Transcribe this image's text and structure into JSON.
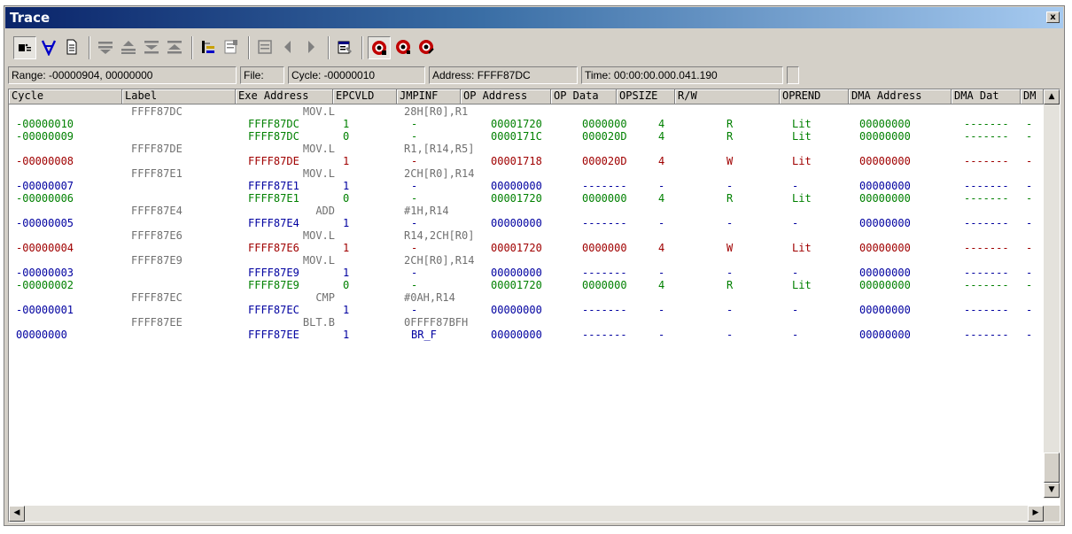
{
  "window": {
    "title": "Trace",
    "close_label": "x"
  },
  "toolbar": {
    "buttons": [
      {
        "icon": "acquisition-icon"
      },
      {
        "icon": "filter-icon"
      },
      {
        "icon": "document-icon"
      },
      {
        "icon": "find-icon"
      },
      {
        "icon": "find-prev-icon"
      },
      {
        "icon": "top-icon"
      },
      {
        "icon": "bottom-icon"
      },
      {
        "icon": "source-icon"
      },
      {
        "icon": "snapshot-icon"
      },
      {
        "icon": "view-icon"
      },
      {
        "icon": "back-icon"
      },
      {
        "icon": "forward-icon"
      },
      {
        "icon": "properties-icon"
      },
      {
        "icon": "trace-start-icon"
      },
      {
        "icon": "trace-stop-icon"
      },
      {
        "icon": "trace-clear-icon"
      }
    ]
  },
  "status": {
    "range": "Range: -00000904,  00000000",
    "file": "File:",
    "cycle": "Cycle: -00000010",
    "address": "Address: FFFF87DC",
    "time": "Time: 00:00:00.000.041.190"
  },
  "columns": [
    "Cycle",
    "Label",
    "Exe Address",
    "EPCVLD",
    "JMPINF",
    "OP Address",
    "OP Data",
    "OPSIZE",
    "R/W",
    "OPREND",
    "DMA Address",
    "DMA Dat",
    "DM"
  ],
  "colors": {
    "green": "#008000",
    "red": "#a00000",
    "blue": "#0000a0",
    "gray": "#707070",
    "toolbar_red": "#c00000",
    "toolbar_blue": "#0000c8"
  },
  "rows": [
    {
      "type": "asm",
      "label": "FFFF87DC",
      "mnemonic": "MOV.L",
      "operand": "28H[R0],R1"
    },
    {
      "type": "data",
      "color": "green",
      "cycle": "-00000010",
      "exe": "FFFF87DC",
      "epc": "1",
      "jmp": "-",
      "opaddr": "00001720",
      "opdata": "0000000",
      "opsize": "4",
      "rw": "R",
      "oprend": "Lit",
      "dmaaddr": "00000000",
      "dmadat": "-------",
      "dm": "-"
    },
    {
      "type": "data",
      "color": "green",
      "cycle": "-00000009",
      "exe": "FFFF87DC",
      "epc": "0",
      "jmp": "-",
      "opaddr": "0000171C",
      "opdata": "000020D",
      "opsize": "4",
      "rw": "R",
      "oprend": "Lit",
      "dmaaddr": "00000000",
      "dmadat": "-------",
      "dm": "-"
    },
    {
      "type": "asm",
      "label": "FFFF87DE",
      "mnemonic": "MOV.L",
      "operand": "R1,[R14,R5]"
    },
    {
      "type": "data",
      "color": "red",
      "cycle": "-00000008",
      "exe": "FFFF87DE",
      "epc": "1",
      "jmp": "-",
      "opaddr": "00001718",
      "opdata": "000020D",
      "opsize": "4",
      "rw": "W",
      "oprend": "Lit",
      "dmaaddr": "00000000",
      "dmadat": "-------",
      "dm": "-"
    },
    {
      "type": "asm",
      "label": "FFFF87E1",
      "mnemonic": "MOV.L",
      "operand": "2CH[R0],R14"
    },
    {
      "type": "data",
      "color": "blue",
      "cycle": "-00000007",
      "exe": "FFFF87E1",
      "epc": "1",
      "jmp": "-",
      "opaddr": "00000000",
      "opdata": "-------",
      "opsize": "-",
      "rw": "-",
      "oprend": "-",
      "dmaaddr": "00000000",
      "dmadat": "-------",
      "dm": "-"
    },
    {
      "type": "data",
      "color": "green",
      "cycle": "-00000006",
      "exe": "FFFF87E1",
      "epc": "0",
      "jmp": "-",
      "opaddr": "00001720",
      "opdata": "0000000",
      "opsize": "4",
      "rw": "R",
      "oprend": "Lit",
      "dmaaddr": "00000000",
      "dmadat": "-------",
      "dm": "-"
    },
    {
      "type": "asm",
      "label": "FFFF87E4",
      "mnemonic": "ADD",
      "operand": "#1H,R14"
    },
    {
      "type": "data",
      "color": "blue",
      "cycle": "-00000005",
      "exe": "FFFF87E4",
      "epc": "1",
      "jmp": "-",
      "opaddr": "00000000",
      "opdata": "-------",
      "opsize": "-",
      "rw": "-",
      "oprend": "-",
      "dmaaddr": "00000000",
      "dmadat": "-------",
      "dm": "-"
    },
    {
      "type": "asm",
      "label": "FFFF87E6",
      "mnemonic": "MOV.L",
      "operand": "R14,2CH[R0]"
    },
    {
      "type": "data",
      "color": "red",
      "cycle": "-00000004",
      "exe": "FFFF87E6",
      "epc": "1",
      "jmp": "-",
      "opaddr": "00001720",
      "opdata": "0000000",
      "opsize": "4",
      "rw": "W",
      "oprend": "Lit",
      "dmaaddr": "00000000",
      "dmadat": "-------",
      "dm": "-"
    },
    {
      "type": "asm",
      "label": "FFFF87E9",
      "mnemonic": "MOV.L",
      "operand": "2CH[R0],R14"
    },
    {
      "type": "data",
      "color": "blue",
      "cycle": "-00000003",
      "exe": "FFFF87E9",
      "epc": "1",
      "jmp": "-",
      "opaddr": "00000000",
      "opdata": "-------",
      "opsize": "-",
      "rw": "-",
      "oprend": "-",
      "dmaaddr": "00000000",
      "dmadat": "-------",
      "dm": "-"
    },
    {
      "type": "data",
      "color": "green",
      "cycle": "-00000002",
      "exe": "FFFF87E9",
      "epc": "0",
      "jmp": "-",
      "opaddr": "00001720",
      "opdata": "0000000",
      "opsize": "4",
      "rw": "R",
      "oprend": "Lit",
      "dmaaddr": "00000000",
      "dmadat": "-------",
      "dm": "-"
    },
    {
      "type": "asm",
      "label": "FFFF87EC",
      "mnemonic": "CMP",
      "operand": "#0AH,R14"
    },
    {
      "type": "data",
      "color": "blue",
      "cycle": "-00000001",
      "exe": "FFFF87EC",
      "epc": "1",
      "jmp": "-",
      "opaddr": "00000000",
      "opdata": "-------",
      "opsize": "-",
      "rw": "-",
      "oprend": "-",
      "dmaaddr": "00000000",
      "dmadat": "-------",
      "dm": "-"
    },
    {
      "type": "asm",
      "label": "FFFF87EE",
      "mnemonic": "BLT.B",
      "operand": "0FFFF87BFH"
    },
    {
      "type": "data",
      "color": "blue",
      "cycle": "00000000",
      "exe": "FFFF87EE",
      "epc": "1",
      "jmp": "BR_F",
      "opaddr": "00000000",
      "opdata": "-------",
      "opsize": "-",
      "rw": "-",
      "oprend": "-",
      "dmaaddr": "00000000",
      "dmadat": "-------",
      "dm": "-"
    }
  ]
}
